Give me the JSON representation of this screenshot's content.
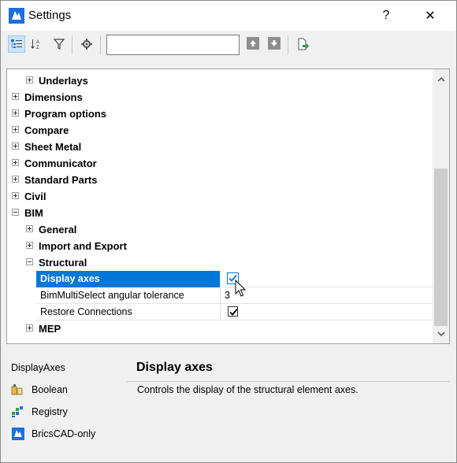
{
  "window": {
    "title": "Settings",
    "help_label": "?",
    "close_label": "✕"
  },
  "toolbar": {
    "search_value": "",
    "buttons": [
      "categorized-view-icon",
      "alphabetical-sort-icon",
      "filter-icon",
      "settings-gear-icon"
    ],
    "nav": [
      "up-arrow-icon",
      "down-arrow-icon",
      "export-icon"
    ]
  },
  "tree": {
    "rows": [
      {
        "label": "Underlays",
        "level": 1,
        "state": "collapsed"
      },
      {
        "label": "Dimensions",
        "level": 0,
        "state": "collapsed"
      },
      {
        "label": "Program options",
        "level": 0,
        "state": "collapsed"
      },
      {
        "label": "Compare",
        "level": 0,
        "state": "collapsed"
      },
      {
        "label": "Sheet Metal",
        "level": 0,
        "state": "collapsed"
      },
      {
        "label": "Communicator",
        "level": 0,
        "state": "collapsed"
      },
      {
        "label": "Standard Parts",
        "level": 0,
        "state": "collapsed"
      },
      {
        "label": "Civil",
        "level": 0,
        "state": "collapsed"
      },
      {
        "label": "BIM",
        "level": 0,
        "state": "expanded"
      },
      {
        "label": "General",
        "level": 1,
        "state": "collapsed"
      },
      {
        "label": "Import and Export",
        "level": 1,
        "state": "collapsed"
      },
      {
        "label": "Structural",
        "level": 1,
        "state": "expanded"
      }
    ],
    "properties": [
      {
        "name": "Display axes",
        "value": "",
        "checked": true,
        "selected": true
      },
      {
        "name": "BimMultiSelect angular tolerance",
        "value": "3",
        "checked": null,
        "selected": false
      },
      {
        "name": "Restore Connections",
        "value": "",
        "checked": true,
        "selected": false
      }
    ],
    "after": {
      "label": "MEP",
      "level": 1,
      "state": "collapsed"
    }
  },
  "info": {
    "variable_name": "DisplayAxes",
    "type_label": "Boolean",
    "storage_label": "Registry",
    "product_label": "BricsCAD-only"
  },
  "description": {
    "title": "Display axes",
    "text": "Controls the display of the structural element axes."
  },
  "colors": {
    "selection": "#0078d7",
    "app_icon": "#1e6fd9"
  }
}
